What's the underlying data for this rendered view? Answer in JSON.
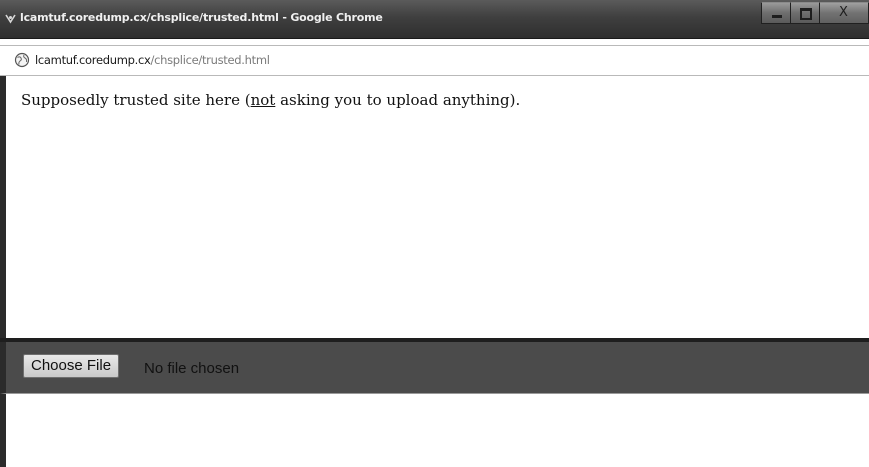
{
  "window": {
    "title": "lcamtuf.coredump.cx/chsplice/trusted.html - Google Chrome",
    "close_glyph": "X"
  },
  "address": {
    "url_host": "lcamtuf.coredump.cx",
    "url_path": "/chsplice/trusted.html"
  },
  "page": {
    "text_before": "Supposedly trusted site here (",
    "text_link": "not",
    "text_after": " asking you to upload anything)."
  },
  "file_input": {
    "button_label": "Choose File",
    "status": "No file chosen"
  },
  "icons": {
    "app": "chrome-app-icon",
    "address": "globe-icon",
    "minimize": "minimize-icon",
    "maximize": "maximize-icon",
    "close": "close-icon"
  },
  "colors": {
    "titlebar": "#3f3f3f",
    "file_strip": "#4b4b4b",
    "url_path": "#7a7a7a"
  }
}
